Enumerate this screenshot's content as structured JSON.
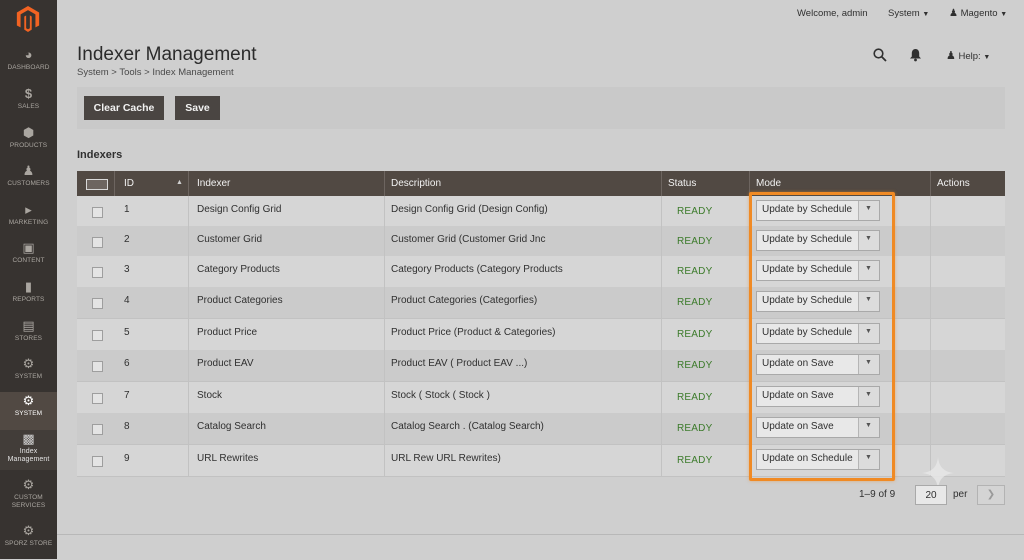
{
  "sidebar": {
    "items": [
      {
        "label": "DASHBOARD",
        "icon": "dashboard-icon"
      },
      {
        "label": "SALES",
        "icon": "dollar-icon"
      },
      {
        "label": "PRODUCTS",
        "icon": "cube-icon"
      },
      {
        "label": "CUSTOMERS",
        "icon": "person-icon"
      },
      {
        "label": "MARKETING",
        "icon": "megaphone-icon"
      },
      {
        "label": "CONTENT",
        "icon": "content-icon"
      },
      {
        "label": "REPORTS",
        "icon": "bar-chart-icon"
      },
      {
        "label": "STORES",
        "icon": "store-icon"
      },
      {
        "label": "SYSTEM",
        "icon": "gear-icon"
      },
      {
        "label": "SYSTEM",
        "icon": "gear-icon"
      },
      {
        "label": "Index Management",
        "icon": "index-icon"
      },
      {
        "label": "CUSTOM SERVICES",
        "icon": "gear-icon"
      },
      {
        "label": "SPORZ STORE",
        "icon": "gear-icon"
      }
    ]
  },
  "topbar": {
    "welcome": "Welcome, admin",
    "system": "System",
    "user": "Magento"
  },
  "header": {
    "title": "Indexer Management",
    "breadcrumb": "System > Tools > Index Management",
    "help": "Help:"
  },
  "actions": {
    "clear_cache": "Clear Cache",
    "save": "Save"
  },
  "section_title": "Indexers",
  "table": {
    "columns": {
      "id": "ID",
      "indexer": "Indexer",
      "description": "Description",
      "status": "Status",
      "mode": "Mode",
      "actions": "Actions"
    },
    "rows": [
      {
        "id": "1",
        "indexer": "Design Config Grid",
        "description": "Design Config Grid (Design Config)",
        "status": "READY",
        "mode": "Update by Schedule"
      },
      {
        "id": "2",
        "indexer": "Customer Grid",
        "description": "Customer Grid (Customer Grid Jnc",
        "status": "READY",
        "mode": "Update by Schedule"
      },
      {
        "id": "3",
        "indexer": "Category Products",
        "description": "Category Products (Category Products",
        "status": "READY",
        "mode": "Update by Schedule"
      },
      {
        "id": "4",
        "indexer": "Product Categories",
        "description": "Product Categories (Categorfies)",
        "status": "READY",
        "mode": "Update by Schedule"
      },
      {
        "id": "5",
        "indexer": "Product Price",
        "description": "Product Price (Product & Categories)",
        "status": "READY",
        "mode": "Update by Schedule"
      },
      {
        "id": "6",
        "indexer": "Product EAV",
        "description": "Product EAV ( Product EAV ...)",
        "status": "READY",
        "mode": "Update on Save"
      },
      {
        "id": "7",
        "indexer": "Stock",
        "description": "Stock ( Stock ( Stock )",
        "status": "READY",
        "mode": "Update on Save"
      },
      {
        "id": "8",
        "indexer": "Catalog Search",
        "description": "Catalog Search . (Catalog Search)",
        "status": "READY",
        "mode": "Update on Save"
      },
      {
        "id": "9",
        "indexer": "URL Rewrites",
        "description": "URL Rew URL Rewrites)",
        "status": "READY",
        "mode": "Update on Schedule"
      }
    ]
  },
  "pager": {
    "range": "1–9 of 9",
    "per_page": "20",
    "per_label": "per"
  },
  "colors": {
    "sidebar": "#373330",
    "header_row": "#514943",
    "button": "#4a4542",
    "status_ready": "#3c7b2b",
    "highlight": "#f08a24"
  }
}
